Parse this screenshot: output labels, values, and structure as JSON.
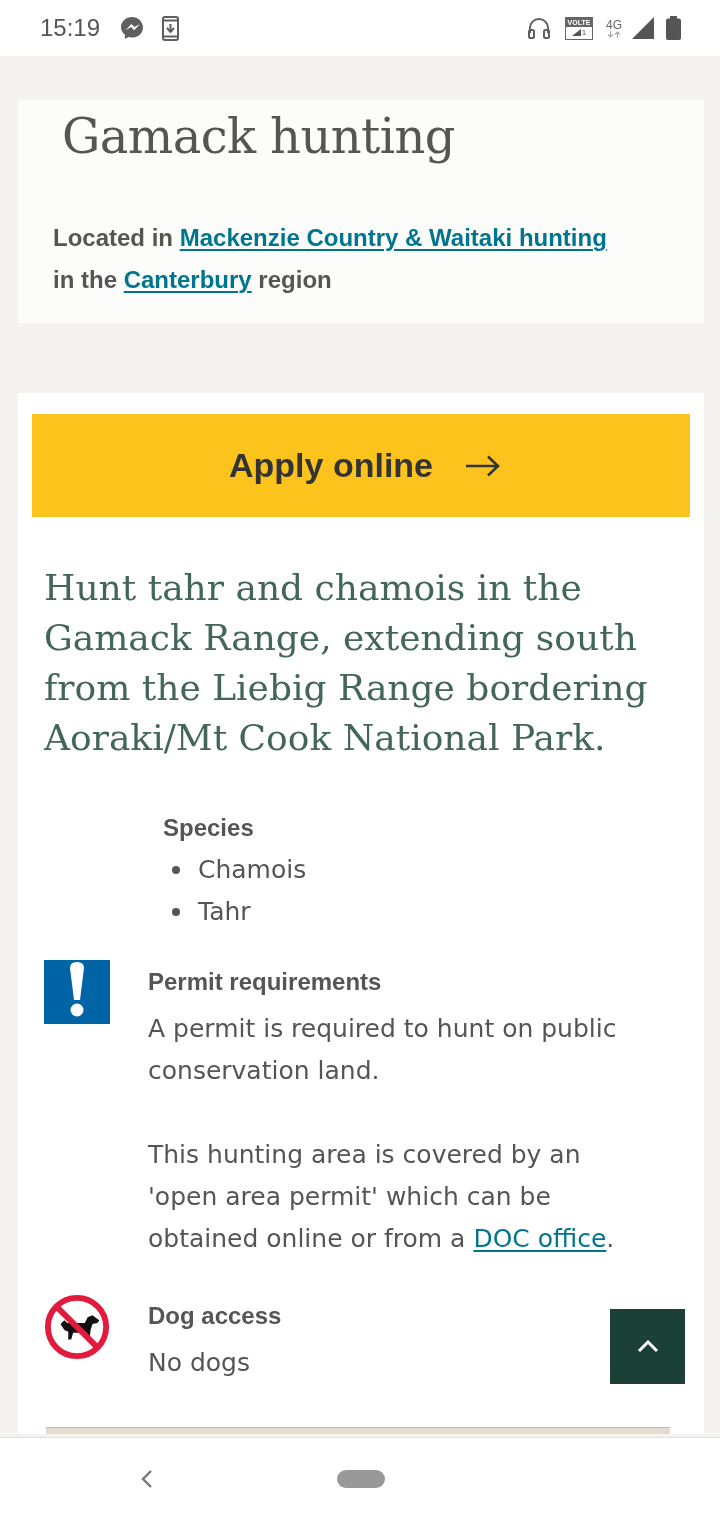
{
  "status_bar": {
    "time": "15:19",
    "volte": "VOLTE",
    "sim": "1",
    "network": "4G"
  },
  "header": {
    "title": "Gamack hunting",
    "location": [
      {
        "kind": "text",
        "text": "Located in "
      },
      {
        "kind": "link",
        "text": "Mackenzie Country & Waitaki hunting"
      },
      {
        "kind": "text",
        "text": " in the "
      },
      {
        "kind": "link",
        "text": "Canterbury"
      },
      {
        "kind": "text",
        "text": " region"
      }
    ]
  },
  "apply_button": {
    "label": "Apply online"
  },
  "intro": "Hunt tahr and chamois in the Gamack Range, extending south from the Liebig Range bordering Aoraki/Mt Cook National Park.",
  "species": {
    "heading": "Species",
    "items": [
      "Chamois",
      "Tahr"
    ]
  },
  "requirements": [
    {
      "kind": "permit",
      "heading": "Permit requirements",
      "paragraphs": [
        [
          {
            "kind": "text",
            "text": "A permit is required to hunt on public conservation land."
          }
        ],
        [
          {
            "kind": "text",
            "text": "This hunting area is covered by an 'open area permit' which can be obtained online or from a "
          },
          {
            "kind": "link",
            "text": "DOC office"
          },
          {
            "kind": "text",
            "text": "."
          }
        ]
      ]
    },
    {
      "kind": "dogs",
      "heading": "Dog access",
      "paragraphs": [
        [
          {
            "kind": "text",
            "text": "No dogs"
          }
        ]
      ]
    }
  ]
}
